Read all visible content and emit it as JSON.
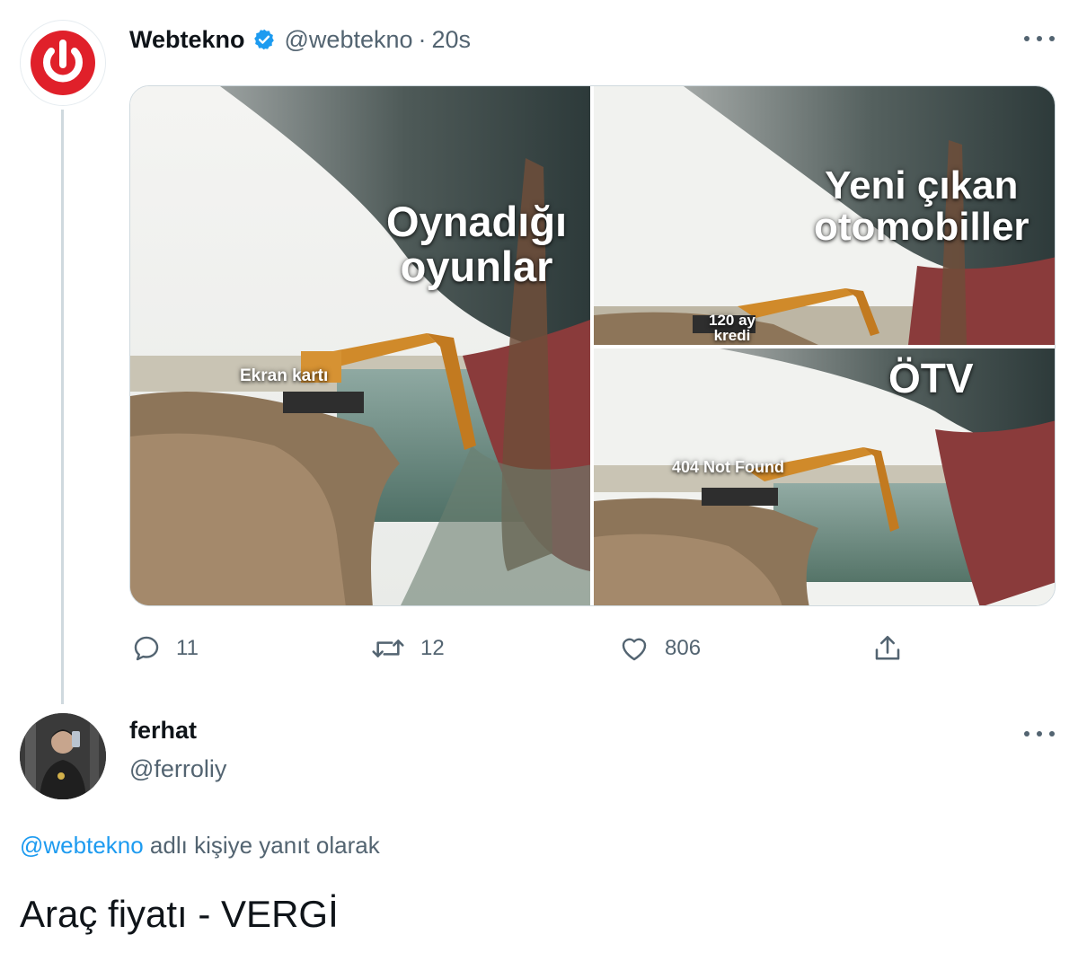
{
  "tweet": {
    "author_name": "Webtekno",
    "handle": "@webtekno",
    "separator": "·",
    "time": "20s",
    "media": {
      "panel1": {
        "caption_big": [
          "Oynadığı",
          "oyunlar"
        ],
        "caption_small": "Ekran kartı"
      },
      "panel2": {
        "caption_big": [
          "Yeni çıkan",
          "otomobiller"
        ],
        "caption_small": [
          "120 ay",
          "kredi"
        ]
      },
      "panel3": {
        "caption_big": "ÖTV",
        "caption_small": "404 Not Found"
      }
    },
    "actions": {
      "replies": "11",
      "retweets": "12",
      "likes": "806"
    }
  },
  "reply": {
    "author_name": "ferhat",
    "handle": "@ferroliy",
    "reply_to_mention": "@webtekno",
    "reply_to_suffix": " adlı kişiye yanıt olarak",
    "text": "Araç fiyatı - VERGİ"
  },
  "colors": {
    "accent": "#1d9bf0",
    "secondary_text": "#536471",
    "logo_red": "#e0202a"
  },
  "icons": [
    "webtekno-power-logo",
    "verified-badge-icon",
    "more-icon",
    "reply-icon",
    "retweet-icon",
    "like-icon",
    "share-icon"
  ]
}
